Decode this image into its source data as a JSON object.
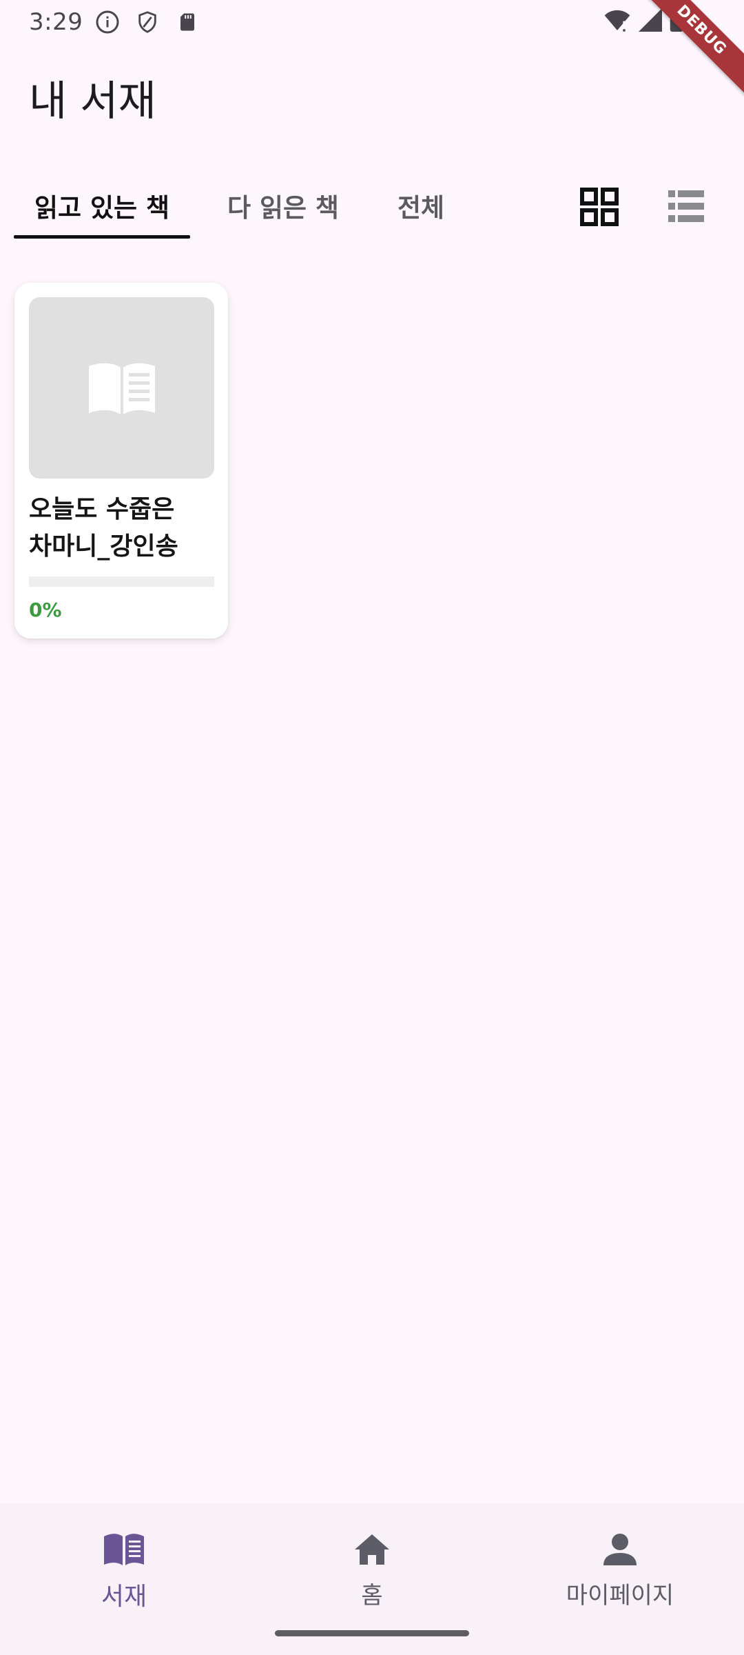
{
  "status_bar": {
    "time": "3:29",
    "left_icons": [
      "info-icon",
      "shield-icon",
      "sd-card-icon"
    ],
    "right_icons": [
      "wifi-icon",
      "signal-icon",
      "battery-icon"
    ],
    "debug_banner": "DEBUG"
  },
  "app_bar": {
    "title": "내 서재"
  },
  "tabs": [
    {
      "label": "읽고 있는 책",
      "active": true
    },
    {
      "label": "다 읽은 책",
      "active": false
    },
    {
      "label": "전체",
      "active": false
    }
  ],
  "view_toggles": {
    "grid_icon": "grid-view-icon",
    "list_icon": "list-view-icon",
    "selected": "grid"
  },
  "books": [
    {
      "title": "오늘도 수줍은 차마니_강인송",
      "cover_icon": "book-open-icon",
      "progress_percent": 0,
      "progress_label": "0%"
    }
  ],
  "bottom_nav": [
    {
      "label": "서재",
      "icon": "library-book-icon",
      "active": true
    },
    {
      "label": "홈",
      "icon": "home-icon",
      "active": false
    },
    {
      "label": "마이페이지",
      "icon": "person-icon",
      "active": false
    }
  ],
  "colors": {
    "background": "#fdf7fd",
    "accent_nav": "#6a5596",
    "progress": "#3c9a3f",
    "debug_ribbon": "#a83539"
  }
}
